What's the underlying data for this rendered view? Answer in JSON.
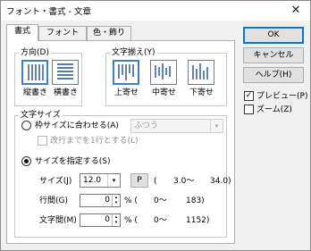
{
  "window": {
    "title": "フォント・書式 - 文章",
    "close_glyph": "✕"
  },
  "tabs": [
    {
      "label": "書式",
      "active": true
    },
    {
      "label": "フォント",
      "active": false
    },
    {
      "label": "色・飾り",
      "active": false
    }
  ],
  "direction": {
    "label": "方向(D)",
    "options": [
      {
        "label": "縦書き",
        "selected": true
      },
      {
        "label": "横書き",
        "selected": false
      }
    ]
  },
  "alignment": {
    "label": "文字揃え(Y)",
    "options": [
      {
        "label": "上寄せ",
        "selected": true
      },
      {
        "label": "中寄せ",
        "selected": false
      },
      {
        "label": "下寄せ",
        "selected": false
      }
    ]
  },
  "char_size": {
    "label": "文字サイズ",
    "fit_frame": {
      "label": "枠サイズに合わせる(A)",
      "checked": false,
      "select_value": "ふつう",
      "wrap_label": "改行までを1行とする(L)"
    },
    "specify": {
      "label": "サイズを指定する(S)",
      "checked": true,
      "size_label": "サイズ(J)",
      "size_value": "12.0",
      "p_button": "P",
      "size_range_open": "(",
      "size_min": "3.0〜",
      "size_max": "34.0)",
      "line_label": "行間(G)",
      "line_value": "0",
      "line_unit": "% (",
      "line_range_min": "0〜",
      "line_range_max": "183)",
      "char_label": "文字間(M)",
      "char_value": "0",
      "char_unit": "% (",
      "char_range_min": "0〜",
      "char_range_max": "1152)"
    }
  },
  "buttons": {
    "ok": "OK",
    "cancel": "キャンセル",
    "help": "ヘルプ(H)"
  },
  "checkboxes": {
    "preview": {
      "label": "プレビュー(P)",
      "checked": true
    },
    "zoom": {
      "label": "ズーム(Z)",
      "checked": false
    }
  },
  "icons": {
    "checkmark": "✓",
    "dropdown": "▾",
    "spin_up": "▴",
    "spin_down": "▾"
  },
  "colors": {
    "accent": "#0078d7",
    "selected_border": "#3f7fc8",
    "icon_blue": "#1f4e8c"
  }
}
